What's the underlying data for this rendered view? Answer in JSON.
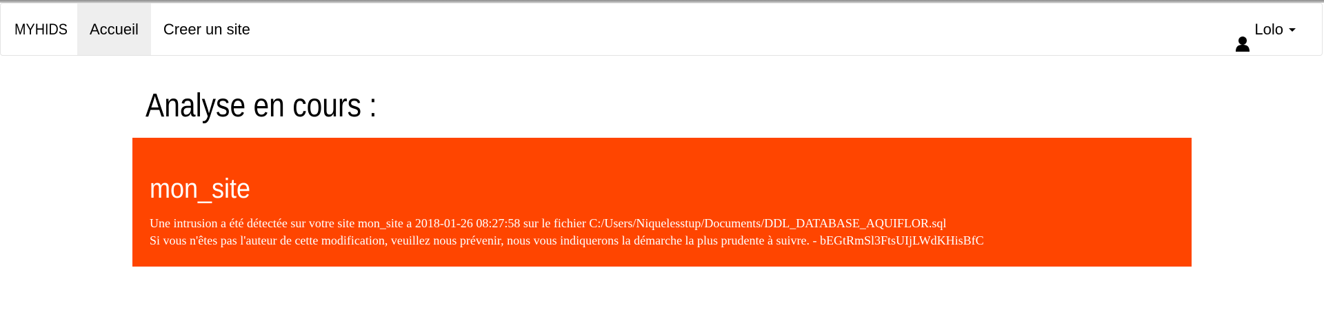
{
  "navbar": {
    "brand": "MYHIDS",
    "links": [
      {
        "label": "Accueil",
        "active": true
      },
      {
        "label": "Creer un site",
        "active": false
      }
    ],
    "user": {
      "name": "Lolo",
      "icon": "user-icon"
    }
  },
  "main": {
    "title": "Analyse en cours :",
    "alert": {
      "site_name": "mon_site",
      "line1": "Une intrusion a été détectée sur votre site mon_site a 2018-01-26 08:27:58 sur le fichier C:/Users/Niquelesstup/Documents/DDL_DATABASE_AQUIFLOR.sql",
      "line2": "Si vous n'êtes pas l'auteur de cette modification, veuillez nous prévenir, nous vous indiquerons la démarche la plus prudente à suivre. - bEGtRmSl3FtsUIjLWdKHisBfC",
      "background_color": "#ff4500"
    }
  },
  "colors": {
    "nav_active_bg": "#eeeeee",
    "alert_bg": "#ff4500",
    "alert_text": "#ffffff"
  }
}
